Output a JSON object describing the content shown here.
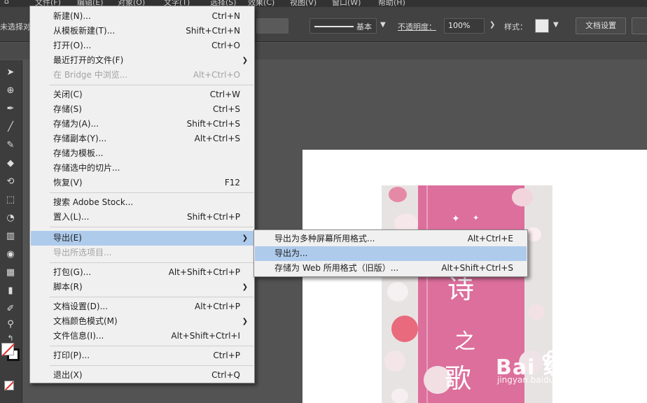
{
  "menubar": {
    "items": [
      "文件(F)",
      "编辑(E)",
      "对象(O)",
      "文字(T)",
      "选择(S)",
      "效果(C)",
      "视图(V)",
      "窗口(W)",
      "帮助(H)"
    ]
  },
  "controlbar": {
    "left_label": "未选择对象",
    "stroke_style": "基本",
    "opacity_label": "不透明度：",
    "opacity_value": "100%",
    "style_label": "样式：",
    "doc_settings": "文档设置"
  },
  "file_menu": {
    "items": [
      {
        "label": "新建(N)...",
        "shortcut": "Ctrl+N"
      },
      {
        "label": "从模板新建(T)...",
        "shortcut": "Shift+Ctrl+N"
      },
      {
        "label": "打开(O)...",
        "shortcut": "Ctrl+O"
      },
      {
        "label": "最近打开的文件(F)",
        "shortcut": ""
      },
      {
        "label": "在 Bridge 中浏览...",
        "shortcut": "Alt+Ctrl+O"
      },
      {
        "label": "关闭(C)",
        "shortcut": "Ctrl+W"
      },
      {
        "label": "存储(S)",
        "shortcut": "Ctrl+S"
      },
      {
        "label": "存储为(A)...",
        "shortcut": "Shift+Ctrl+S"
      },
      {
        "label": "存储副本(Y)...",
        "shortcut": "Alt+Ctrl+S"
      },
      {
        "label": "存储为模板...",
        "shortcut": ""
      },
      {
        "label": "存储选中的切片...",
        "shortcut": ""
      },
      {
        "label": "恢复(V)",
        "shortcut": "F12"
      },
      {
        "label": "搜索 Adobe Stock...",
        "shortcut": ""
      },
      {
        "label": "置入(L)...",
        "shortcut": "Shift+Ctrl+P"
      },
      {
        "label": "导出(E)",
        "shortcut": ""
      },
      {
        "label": "导出所选项目...",
        "shortcut": ""
      },
      {
        "label": "打包(G)...",
        "shortcut": "Alt+Shift+Ctrl+P"
      },
      {
        "label": "脚本(R)",
        "shortcut": ""
      },
      {
        "label": "文档设置(D)...",
        "shortcut": "Alt+Ctrl+P"
      },
      {
        "label": "文档颜色模式(M)",
        "shortcut": ""
      },
      {
        "label": "文件信息(I)...",
        "shortcut": "Alt+Shift+Ctrl+I"
      },
      {
        "label": "打印(P)...",
        "shortcut": "Ctrl+P"
      },
      {
        "label": "退出(X)",
        "shortcut": "Ctrl+Q"
      }
    ]
  },
  "export_submenu": {
    "items": [
      {
        "label": "导出为多种屏幕所用格式...",
        "shortcut": "Alt+Ctrl+E"
      },
      {
        "label": "导出为...",
        "shortcut": ""
      },
      {
        "label": "存储为 Web 所用格式（旧版）...",
        "shortcut": "Alt+Shift+Ctrl+S"
      }
    ]
  },
  "artwork": {
    "calligraphy_1": "诗",
    "calligraphy_2": "之",
    "calligraphy_3": "歌"
  },
  "watermark": {
    "title": "Bai  经验",
    "url": "jingyan.baidu.com"
  },
  "colors": {
    "menu_bg": "#f0f0f0",
    "menu_highlight": "#aecbec",
    "canvas_bg": "#535353",
    "poster_pink": "#dc6f9c"
  },
  "icons": [
    "selection-tool-icon",
    "direct-select-icon",
    "pen-icon",
    "line-icon",
    "brush-icon",
    "eraser-icon",
    "rotate-icon",
    "scale-icon",
    "shape-builder-icon",
    "gradient-icon",
    "eyedropper-icon",
    "blend-icon",
    "graph-icon",
    "slice-icon",
    "hand-icon",
    "zoom-icon",
    "swap-icon"
  ]
}
